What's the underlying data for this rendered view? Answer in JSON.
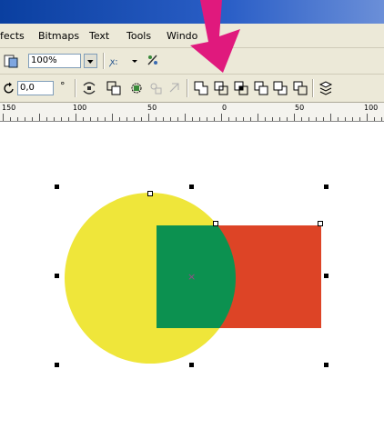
{
  "menu": {
    "items": [
      {
        "label": "Effects",
        "display": "fects"
      },
      {
        "label": "Bitmaps"
      },
      {
        "label": "Text"
      },
      {
        "label": "Tools"
      },
      {
        "label": "Window",
        "display": "Windo"
      }
    ]
  },
  "toolbar": {
    "zoom_value": "100%",
    "rotation_value": "0,0",
    "rotation_unit": "°"
  },
  "ruler": {
    "labels": [
      "150",
      "100",
      "50",
      "0",
      "50",
      "100"
    ]
  },
  "colors": {
    "circle": "#efe63a",
    "rectangle": "#dd4426",
    "intersection": "#0c9150",
    "arrow": "#e0197d",
    "titlebar": "#2b5fc7"
  },
  "canvas": {
    "center_marker": "×"
  }
}
